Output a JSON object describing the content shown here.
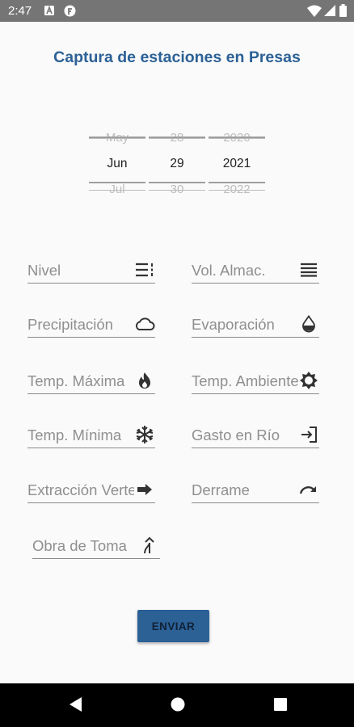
{
  "status_bar": {
    "time": "2:47",
    "icons": [
      "notification-a-icon",
      "notification-f-icon",
      "wifi-icon",
      "signal-icon",
      "battery-icon"
    ]
  },
  "title": "Captura de estaciones en Presas",
  "date_picker": {
    "month": {
      "prev": "May",
      "current": "Jun",
      "next": "Jul"
    },
    "day": {
      "prev": "28",
      "current": "29",
      "next": "30"
    },
    "year": {
      "prev": "2020",
      "current": "2021",
      "next": "2022"
    }
  },
  "fields": {
    "nivel": {
      "placeholder": "Nivel",
      "icon": "list-icon"
    },
    "vol_almac": {
      "placeholder": "Vol. Almac.",
      "icon": "storage-lines-icon"
    },
    "precipitacion": {
      "placeholder": "Precipitación",
      "icon": "cloud-icon"
    },
    "evaporacion": {
      "placeholder": "Evaporación",
      "icon": "drop-icon"
    },
    "temp_maxima": {
      "placeholder": "Temp. Máxima",
      "icon": "fire-icon"
    },
    "temp_ambiente": {
      "placeholder": "Temp. Ambiente",
      "icon": "sun-icon"
    },
    "temp_minima": {
      "placeholder": "Temp. Mínima",
      "icon": "snowflake-icon"
    },
    "gasto_rio": {
      "placeholder": "Gasto en Río",
      "icon": "login-arrow-icon"
    },
    "extraccion": {
      "placeholder": "Extracción Vertedor",
      "icon": "arrow-right-icon"
    },
    "derrame": {
      "placeholder": "Derrame",
      "icon": "redo-arrow-icon"
    },
    "obra_toma": {
      "placeholder": "Obra de Toma",
      "icon": "merge-icon"
    }
  },
  "submit_label": "ENVIAR",
  "colors": {
    "accent": "#2c6196",
    "status_bar": "#757575",
    "nav_bar": "#000000"
  }
}
